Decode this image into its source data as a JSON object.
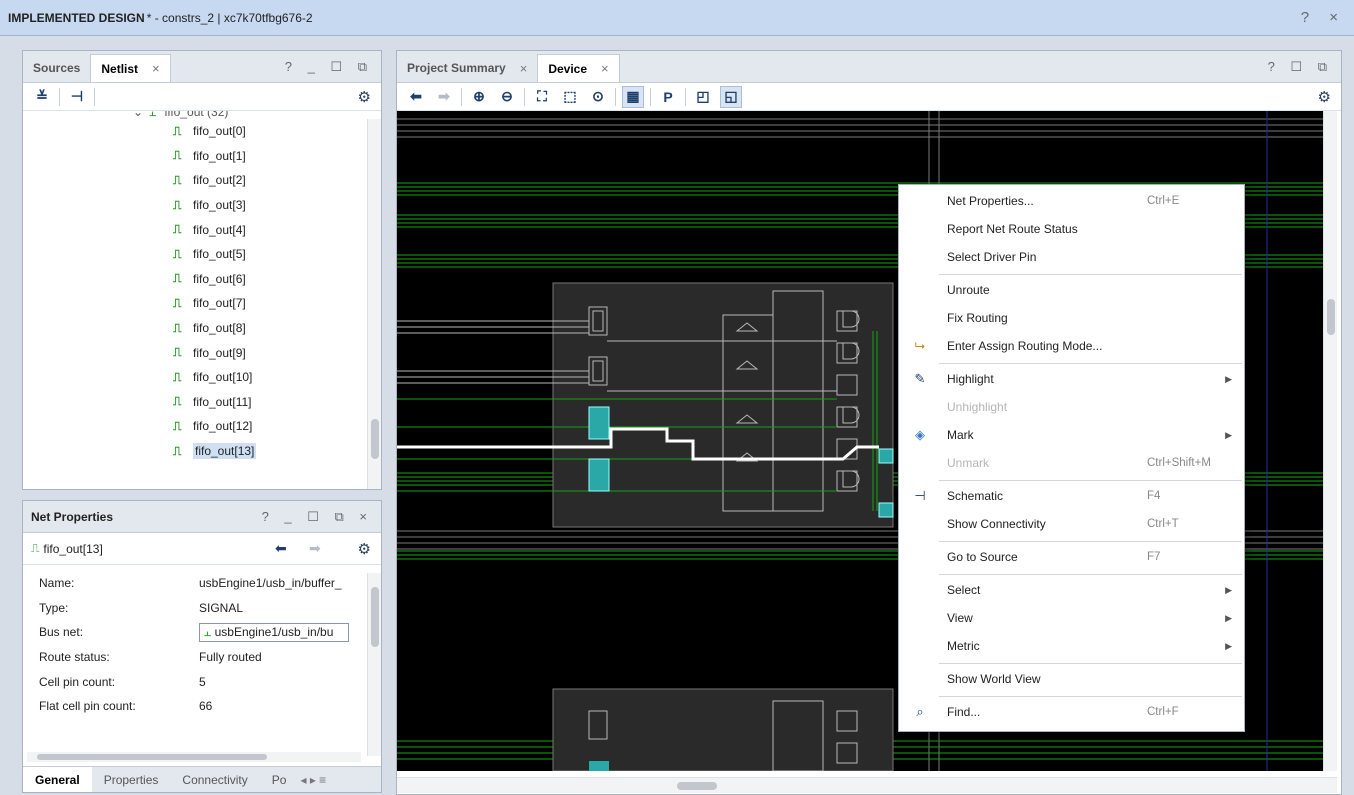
{
  "title": {
    "main": "IMPLEMENTED DESIGN",
    "rest": " * - constrs_2 | xc7k70tfbg676-2",
    "controls": "? ×"
  },
  "netlist_panel": {
    "tabs": [
      "Sources",
      "Netlist"
    ],
    "close": "×",
    "controls": "? _ ☐ ⧉",
    "tree_top": "fifo_out (32)",
    "items": [
      "fifo_out[0]",
      "fifo_out[1]",
      "fifo_out[2]",
      "fifo_out[3]",
      "fifo_out[4]",
      "fifo_out[5]",
      "fifo_out[6]",
      "fifo_out[7]",
      "fifo_out[8]",
      "fifo_out[9]",
      "fifo_out[10]",
      "fifo_out[11]",
      "fifo_out[12]",
      "fifo_out[13]"
    ],
    "selected_index": 13
  },
  "net_properties": {
    "title": "Net Properties",
    "controls": "? _ ☐ ⧉ ×",
    "net_name": "fifo_out[13]",
    "rows": [
      {
        "key": "Name:",
        "value": "usbEngine1/usb_in/buffer_"
      },
      {
        "key": "Type:",
        "value": "SIGNAL"
      },
      {
        "key": "Bus net:",
        "value": "usbEngine1/usb_in/bu"
      },
      {
        "key": "Route status:",
        "value": "Fully routed"
      },
      {
        "key": "Cell pin count:",
        "value": "5"
      },
      {
        "key": "Flat cell pin count:",
        "value": "66"
      }
    ],
    "bottom_tabs": [
      "General",
      "Properties",
      "Connectivity",
      "Po"
    ]
  },
  "device_panel": {
    "tabs": [
      "Project Summary",
      "Device"
    ],
    "close": "×",
    "controls": "? ☐ ⧉"
  },
  "context_menu": {
    "items": [
      {
        "label": "Net Properties...",
        "shortcut": "Ctrl+E",
        "icon": "",
        "submenu": false,
        "disabled": false
      },
      {
        "label": "Report Net Route Status",
        "shortcut": "",
        "icon": "",
        "submenu": false,
        "disabled": false
      },
      {
        "label": "Select Driver Pin",
        "shortcut": "",
        "icon": "",
        "submenu": false,
        "disabled": false,
        "sep_after": true
      },
      {
        "label": "Unroute",
        "shortcut": "",
        "icon": "",
        "submenu": false,
        "disabled": false
      },
      {
        "label": "Fix Routing",
        "shortcut": "",
        "icon": "",
        "submenu": false,
        "disabled": false
      },
      {
        "label": "Enter Assign Routing Mode...",
        "shortcut": "",
        "icon": "route-icon",
        "submenu": false,
        "disabled": false,
        "sep_after": true
      },
      {
        "label": "Highlight",
        "shortcut": "",
        "icon": "highlight-icon",
        "submenu": true,
        "disabled": false
      },
      {
        "label": "Unhighlight",
        "shortcut": "",
        "icon": "",
        "submenu": false,
        "disabled": true
      },
      {
        "label": "Mark",
        "shortcut": "",
        "icon": "mark-icon",
        "submenu": true,
        "disabled": false
      },
      {
        "label": "Unmark",
        "shortcut": "Ctrl+Shift+M",
        "icon": "",
        "submenu": false,
        "disabled": true,
        "sep_after": true
      },
      {
        "label": "Schematic",
        "shortcut": "F4",
        "icon": "schematic-icon",
        "submenu": false,
        "disabled": false
      },
      {
        "label": "Show Connectivity",
        "shortcut": "Ctrl+T",
        "icon": "",
        "submenu": false,
        "disabled": false,
        "sep_after": true
      },
      {
        "label": "Go to Source",
        "shortcut": "F7",
        "icon": "",
        "submenu": false,
        "disabled": false,
        "sep_after": true
      },
      {
        "label": "Select",
        "shortcut": "",
        "icon": "",
        "submenu": true,
        "disabled": false
      },
      {
        "label": "View",
        "shortcut": "",
        "icon": "",
        "submenu": true,
        "disabled": false
      },
      {
        "label": "Metric",
        "shortcut": "",
        "icon": "",
        "submenu": true,
        "disabled": false,
        "sep_after": true
      },
      {
        "label": "Show World View",
        "shortcut": "",
        "icon": "",
        "submenu": false,
        "disabled": false,
        "sep_after": true
      },
      {
        "label": "Find...",
        "shortcut": "Ctrl+F",
        "icon": "find-icon",
        "submenu": false,
        "disabled": false
      }
    ]
  }
}
